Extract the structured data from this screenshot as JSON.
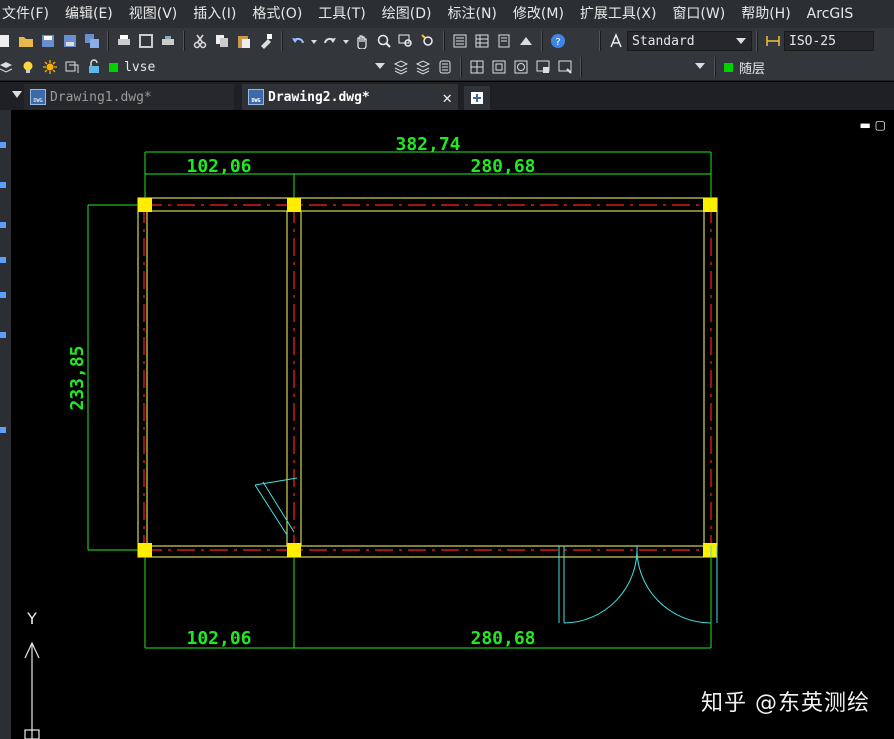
{
  "menu": {
    "items": [
      "文件(F)",
      "编辑(E)",
      "视图(V)",
      "插入(I)",
      "格式(O)",
      "工具(T)",
      "绘图(D)",
      "标注(N)",
      "修改(M)",
      "扩展工具(X)",
      "窗口(W)",
      "帮助(H)",
      "ArcGIS"
    ]
  },
  "toolbar1": {
    "text_style": "Standard",
    "dim_style": "ISO-25"
  },
  "toolbar2": {
    "layer": "lvse",
    "color_label": "随层",
    "colors": {
      "layer_swatch": "#00d200"
    }
  },
  "tabs": [
    {
      "label": "Drawing1.dwg*",
      "active": false
    },
    {
      "label": "Drawing2.dwg*",
      "active": true
    }
  ],
  "drawing": {
    "dimensions": {
      "overall_top": "382,74",
      "top_left": "102,06",
      "top_right": "280,68",
      "left_height": "233,85",
      "bottom_left": "102,06",
      "bottom_right": "280,68"
    },
    "ucs_axis_label": "Y",
    "colors": {
      "wall": "#ffff66",
      "dimension": "#22e822",
      "centerline": "#ff2020",
      "door": "#40e0e0"
    }
  },
  "watermark": "知乎 @东英测绘"
}
